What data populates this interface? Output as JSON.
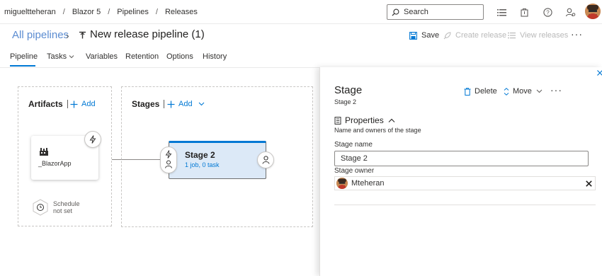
{
  "breadcrumb": [
    "migueltteheran",
    "Blazor 5",
    "Pipelines",
    "Releases"
  ],
  "search": {
    "placeholder": "Search"
  },
  "header": {
    "all_pipelines": "All pipelines",
    "title": "New release pipeline (1)",
    "save": "Save",
    "create_release": "Create release",
    "view_releases": "View releases",
    "more": "···"
  },
  "tabs": [
    "Pipeline",
    "Tasks",
    "Variables",
    "Retention",
    "Options",
    "History"
  ],
  "canvas": {
    "artifacts_title": "Artifacts",
    "artifacts_add": "Add",
    "stages_title": "Stages",
    "stages_add": "Add",
    "artifact_name": "_BlazorApp",
    "schedule_line1": "Schedule",
    "schedule_line2": "not set",
    "stage_name": "Stage 2",
    "stage_summary": "1 job, 0 task"
  },
  "panel": {
    "title": "Stage",
    "subtitle": "Stage 2",
    "delete": "Delete",
    "move": "Move",
    "more": "···",
    "properties_title": "Properties",
    "properties_sub": "Name and owners of the stage",
    "stage_name_label": "Stage name",
    "stage_name_value": "Stage 2",
    "stage_owner_label": "Stage owner",
    "stage_owner_value": "Mteheran"
  },
  "colors": {
    "accent": "#0078d4",
    "stage_fill": "#dce9f7"
  }
}
